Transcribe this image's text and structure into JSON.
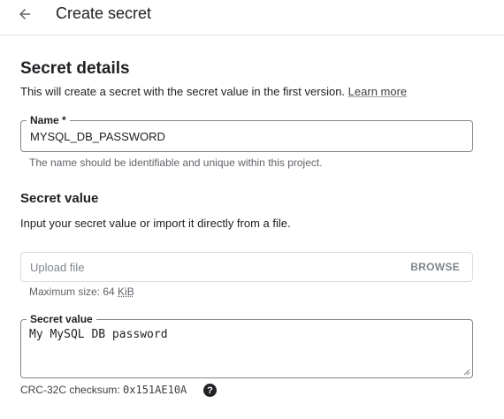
{
  "header": {
    "back_icon": "arrow-back-icon",
    "title": "Create secret"
  },
  "details": {
    "title": "Secret details",
    "description": "This will create a secret with the secret value in the first version.",
    "learn_more": "Learn more"
  },
  "name_field": {
    "label": "Name *",
    "value": "MYSQL_DB_PASSWORD",
    "hint": "The name should be identifiable and unique within this project."
  },
  "secret_value": {
    "title": "Secret value",
    "description": "Input your secret value or import it directly from a file.",
    "upload_placeholder": "Upload file",
    "browse_label": "BROWSE",
    "max_size_prefix": "Maximum size: 64 ",
    "max_size_unit": "KiB",
    "field_label": "Secret value",
    "field_value": "My MySQL DB password",
    "checksum_label": "CRC-32C checksum: ",
    "checksum_value": "0x151AE10A",
    "help_icon": "help-icon"
  },
  "colors": {
    "text": "#202124",
    "hint": "#5f6368",
    "border": "#80868b",
    "disabled": "#80868b"
  }
}
